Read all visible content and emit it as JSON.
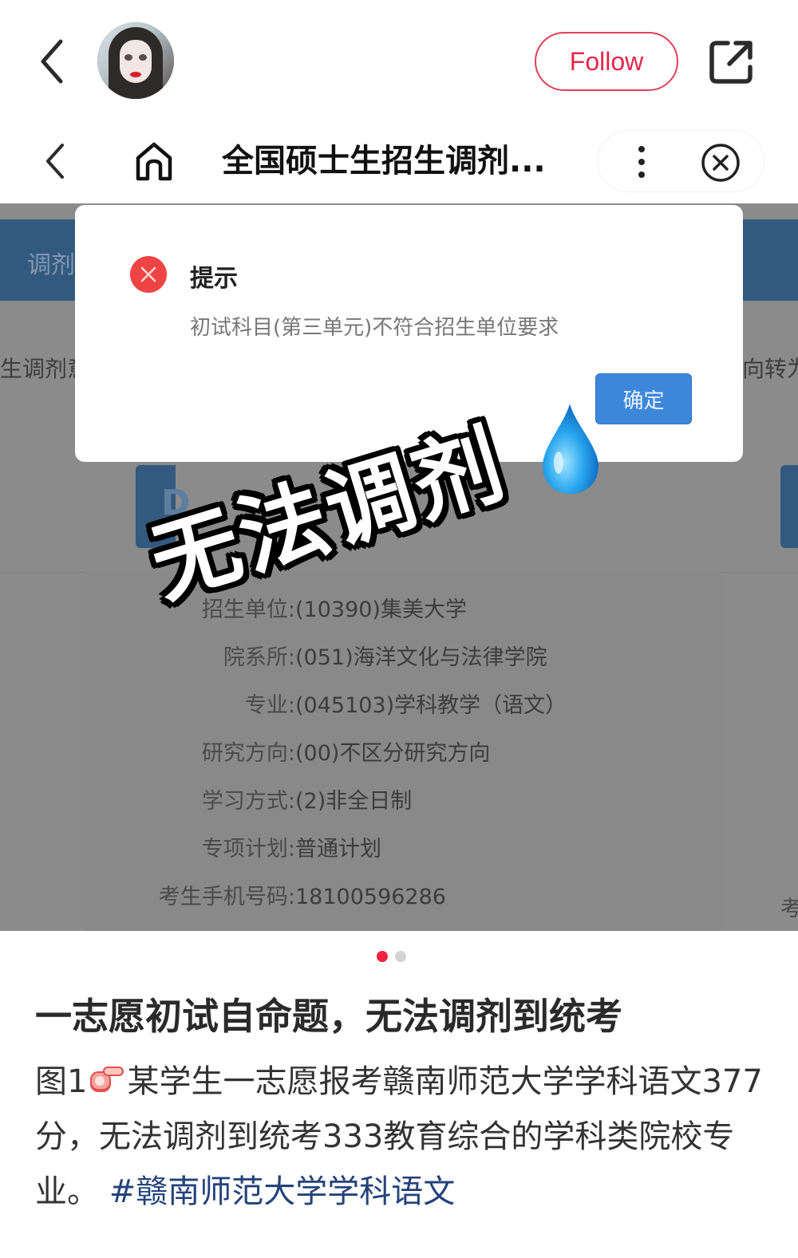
{
  "app_bar": {
    "back_icon": "chevron-left-icon",
    "avatar_alt": "user-avatar",
    "follow_label": "Follow",
    "share_icon": "share-external-icon"
  },
  "web_nav": {
    "back_icon": "chevron-left-icon",
    "home_icon": "home-icon",
    "title": "全国硕士生招生调剂...",
    "more_icon": "more-vertical-icon",
    "close_icon": "close-circle-icon"
  },
  "background_page": {
    "header_band_text": "调剂",
    "left_clipped_text": "生调剂意",
    "right_clipped_text": "向转为",
    "card_glyph": "D",
    "right_clipped_label": "考",
    "fields": [
      {
        "label": "招生单位:",
        "value": "(10390)集美大学"
      },
      {
        "label": "院系所:",
        "value": "(051)海洋文化与法律学院"
      },
      {
        "label": "专业:",
        "value": "(045103)学科教学（语文）"
      },
      {
        "label": "研究方向:",
        "value": "(00)不区分研究方向"
      },
      {
        "label": "学习方式:",
        "value": "(2)非全日制"
      },
      {
        "label": "专项计划:",
        "value": "普通计划"
      },
      {
        "label": "考生手机号码:",
        "value": "18100596286"
      }
    ]
  },
  "modal": {
    "icon": "error-circle-icon",
    "title": "提示",
    "message": "初试科目(第三单元)不符合招生单位要求",
    "ok_label": "确定",
    "colors": {
      "error": "#ef4444",
      "button": "#3d87da"
    }
  },
  "sticker": {
    "text": "无法调剂",
    "emoji": "droplet-icon"
  },
  "carousel": {
    "total": 2,
    "active_index": 0,
    "active_color": "#f2213f"
  },
  "post": {
    "title": "一志愿初试自命题，无法调剂到统考",
    "body_prefix": "图1",
    "body_emoji": "pointing-hand-icon",
    "body_text": "某学生一志愿报考赣南师范大学学科语文377分，无法调剂到统考333教育综合的学科类院校专业。",
    "hashtag": "#赣南师范大学学科语文",
    "hashtag_color": "#24427a"
  },
  "theme": {
    "follow_color": "#e8254a",
    "page_dim": "#8b8b8b",
    "band_blue": "#34597f"
  }
}
